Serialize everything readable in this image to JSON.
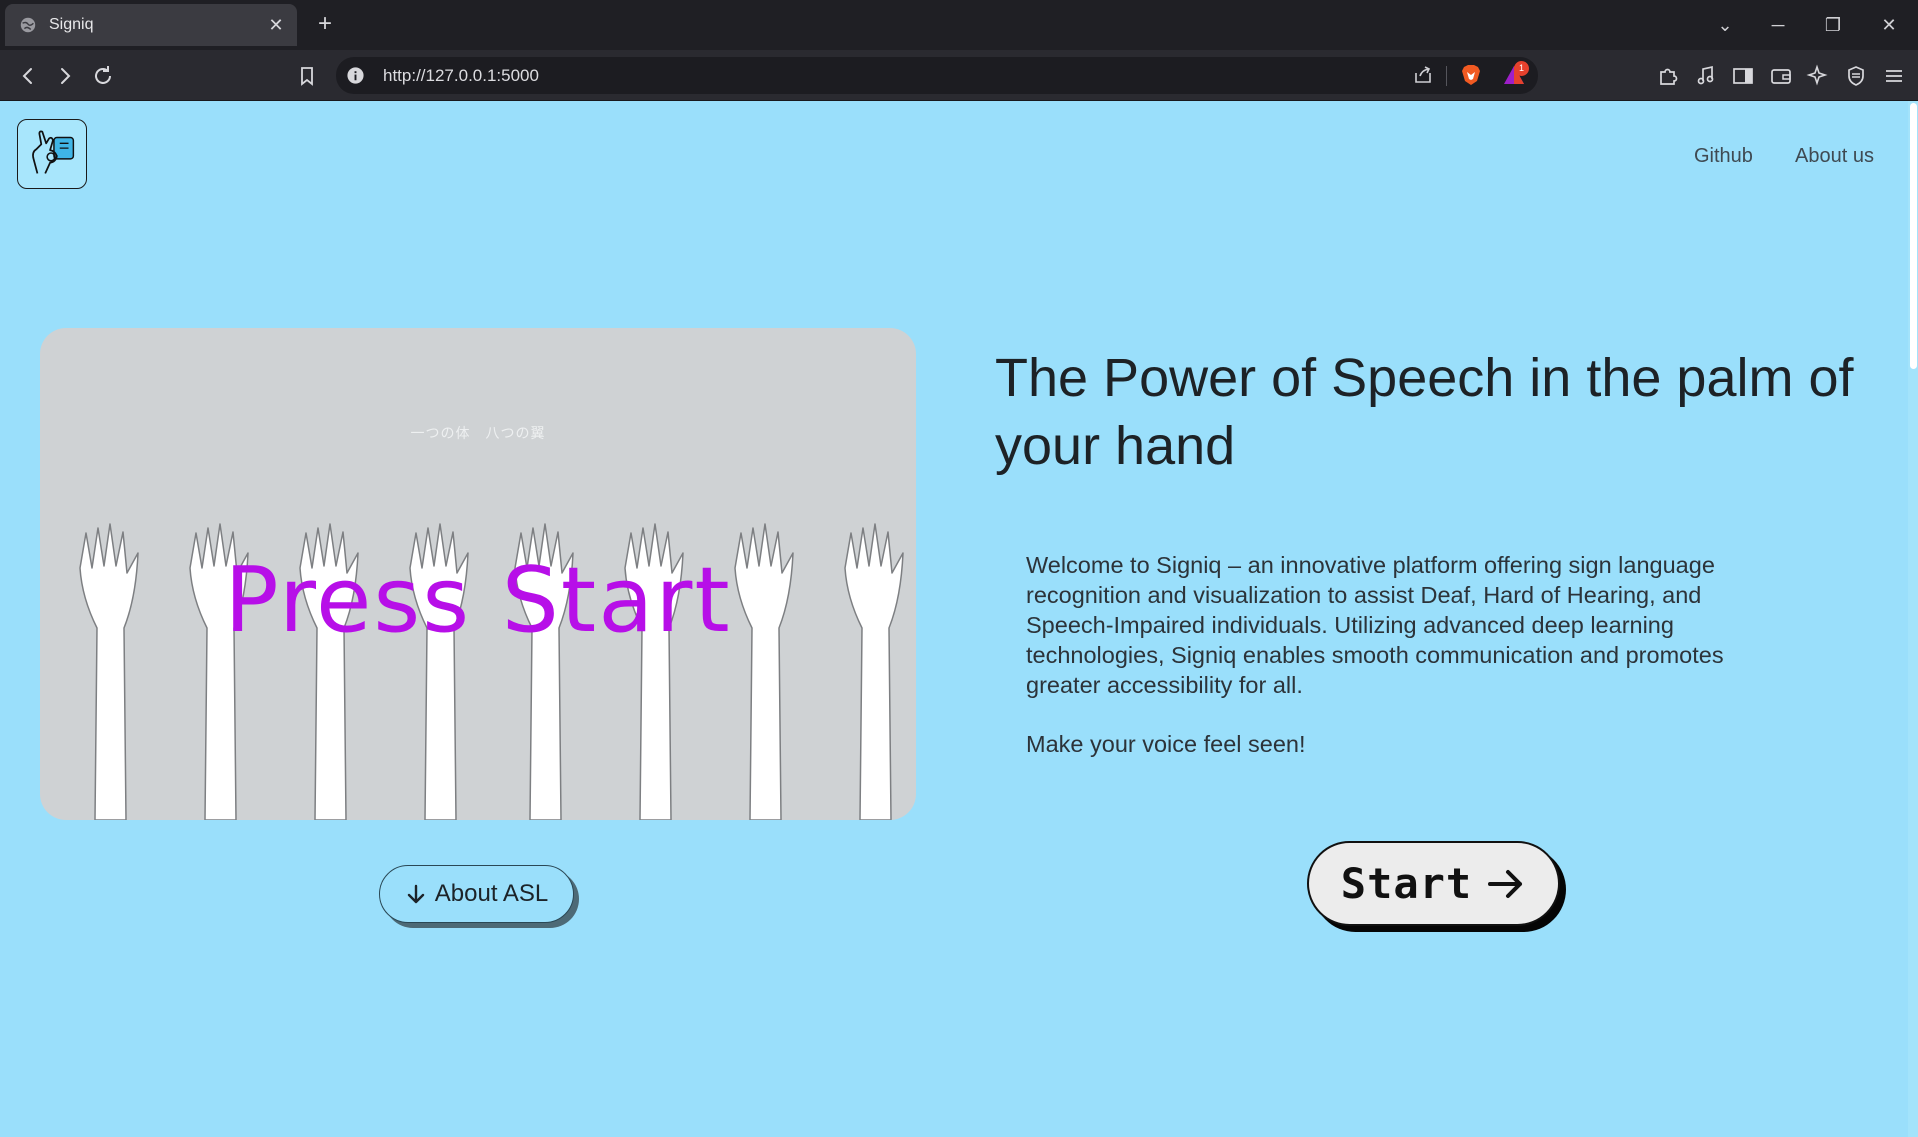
{
  "browser": {
    "tab_title": "Signiq",
    "tab_close": "✕",
    "new_tab": "+",
    "url": "http://127.0.0.1:5000",
    "rewards_badge": "1",
    "window_controls": [
      "⌄",
      "─",
      "❐",
      "✕"
    ]
  },
  "nav": {
    "links": [
      "Github",
      "About us"
    ]
  },
  "hero": {
    "media_caption": "一つの体　八つの翼",
    "media_overlay": "Press Start",
    "about_button": "About ASL",
    "headline": "The Power of Speech in the palm of your hand",
    "description": "Welcome to Signiq – an innovative platform offering sign language recognition and visualization to assist Deaf, Hard of Hearing, and Speech-Impaired individuals. Utilizing advanced deep learning technologies, Signiq enables smooth communication and promotes greater accessibility for all.",
    "tagline": "Make your voice feel seen!",
    "start_button": "Start"
  },
  "colors": {
    "page_background": "#9adffb",
    "overlay_text": "#b70fe8",
    "start_button_fill": "#ececec"
  },
  "icons": [
    "globe-icon",
    "close-icon",
    "plus-icon",
    "back-icon",
    "forward-icon",
    "reload-icon",
    "bookmark-icon",
    "info-icon",
    "share-icon",
    "brave-shield-icon",
    "rewards-icon",
    "extensions-icon",
    "music-icon",
    "sidebar-icon",
    "wallet-icon",
    "leo-ai-icon",
    "vpn-icon",
    "menu-icon",
    "hand-sign-logo-icon",
    "arrow-down-icon",
    "arrow-right-icon"
  ]
}
